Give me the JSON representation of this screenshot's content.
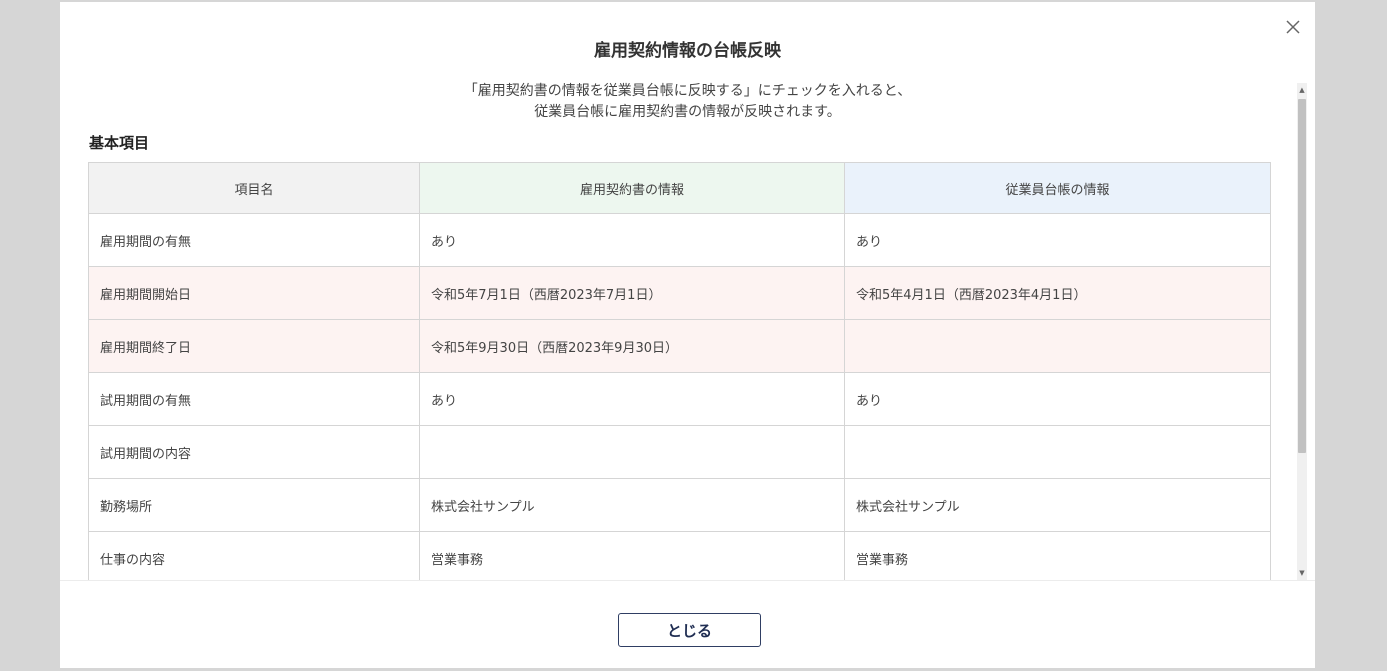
{
  "modal": {
    "title": "雇用契約情報の台帳反映",
    "close_icon": "close-icon",
    "description_line1": "「雇用契約書の情報を従業員台帳に反映する」にチェックを入れると、",
    "description_line2": "従業員台帳に雇用契約書の情報が反映されます。",
    "section_title": "基本項目",
    "table": {
      "headers": [
        "項目名",
        "雇用契約書の情報",
        "従業員台帳の情報"
      ],
      "rows": [
        {
          "item": "雇用期間の有無",
          "contract": "あり",
          "ledger": "あり",
          "diff": false
        },
        {
          "item": "雇用期間開始日",
          "contract": "令和5年7月1日（西暦2023年7月1日）",
          "ledger": "令和5年4月1日（西暦2023年4月1日）",
          "diff": true
        },
        {
          "item": "雇用期間終了日",
          "contract": "令和5年9月30日（西暦2023年9月30日）",
          "ledger": "",
          "diff": true
        },
        {
          "item": "試用期間の有無",
          "contract": "あり",
          "ledger": "あり",
          "diff": false
        },
        {
          "item": "試用期間の内容",
          "contract": "",
          "ledger": "",
          "diff": false
        },
        {
          "item": "勤務場所",
          "contract": "株式会社サンプル",
          "ledger": "株式会社サンプル",
          "diff": false
        },
        {
          "item": "仕事の内容",
          "contract": "営業事務",
          "ledger": "営業事務",
          "diff": false
        }
      ]
    },
    "close_button_label": "とじる"
  },
  "colors": {
    "header_item": "#f2f2f2",
    "header_contract": "#edf7ef",
    "header_ledger": "#eaf2fb",
    "diff_row": "#fdf3f2",
    "button_border": "#2f3e63"
  }
}
